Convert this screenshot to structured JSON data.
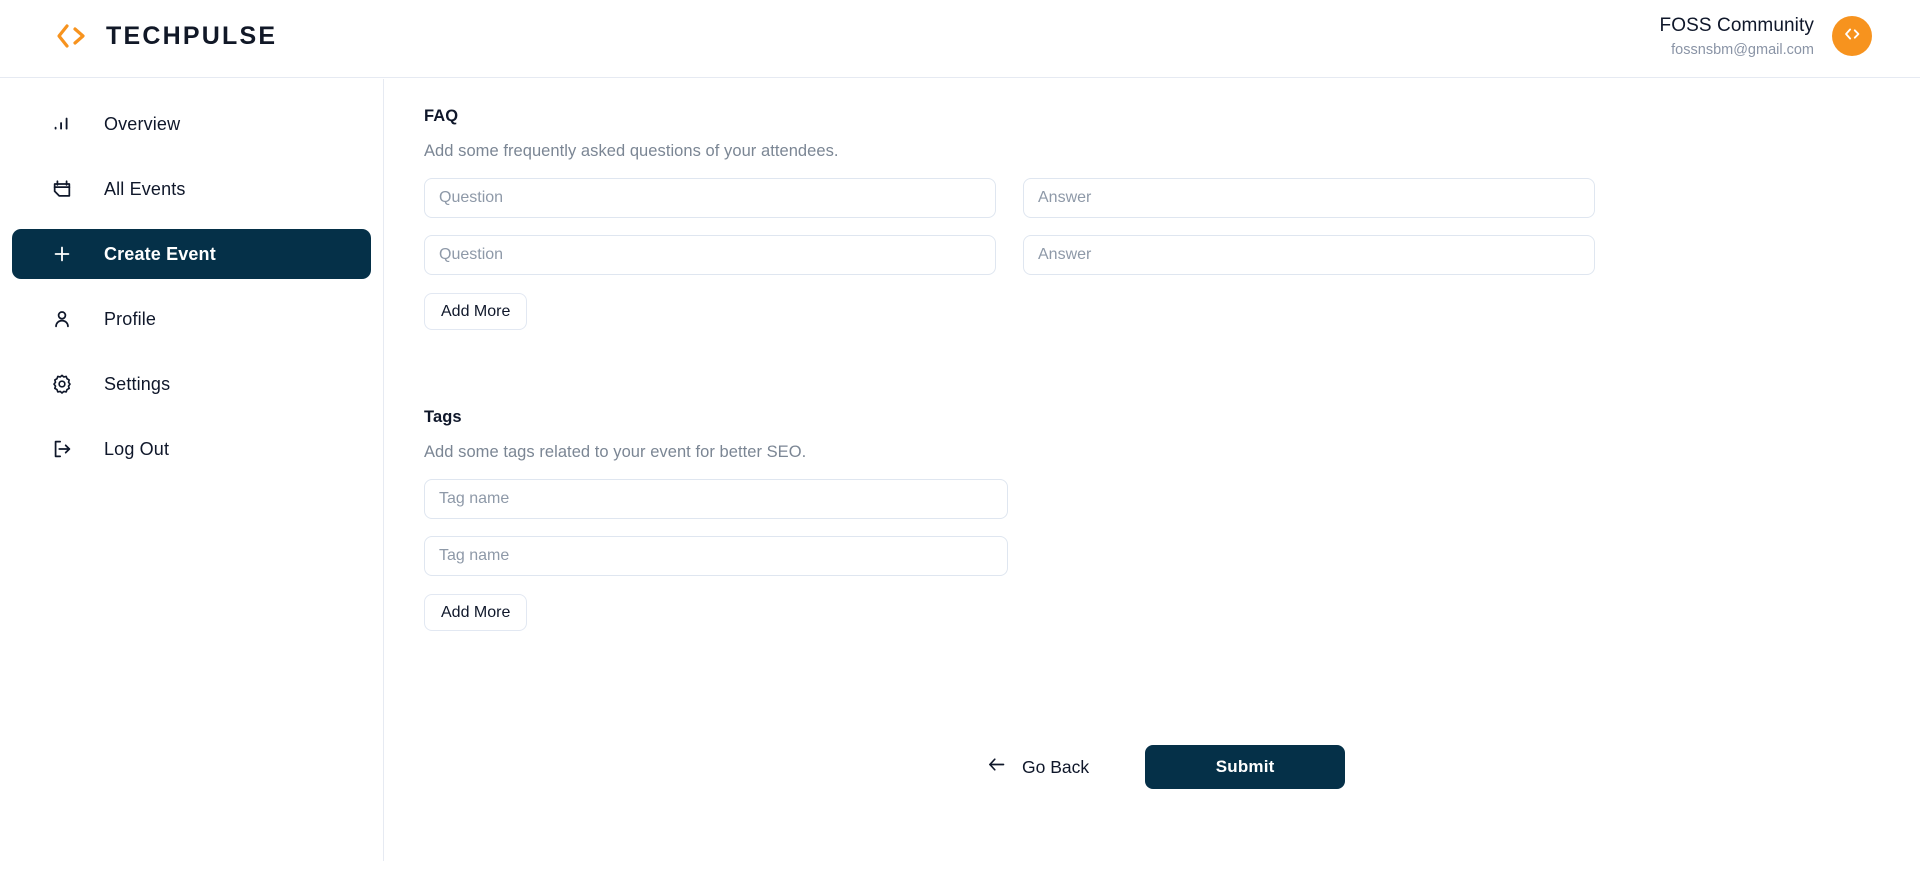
{
  "brand": {
    "name": "TECHPULSE",
    "logo_icon": "code-brackets-icon",
    "accent_color": "#F7931E"
  },
  "header": {
    "user_name": "FOSS Community",
    "user_email": "fossnsbm@gmail.com",
    "avatar_icon": "code-brackets-icon",
    "avatar_color": "#F7931E"
  },
  "sidebar": {
    "items": [
      {
        "label": "Overview",
        "icon": "bar-chart-icon",
        "active": false
      },
      {
        "label": "All Events",
        "icon": "calendar-icon",
        "active": false
      },
      {
        "label": "Create Event",
        "icon": "plus-icon",
        "active": true
      },
      {
        "label": "Profile",
        "icon": "user-icon",
        "active": false
      },
      {
        "label": "Settings",
        "icon": "gear-icon",
        "active": false
      },
      {
        "label": "Log Out",
        "icon": "logout-icon",
        "active": false
      }
    ],
    "active_color": "#053048"
  },
  "main": {
    "faq": {
      "title": "FAQ",
      "subtitle": "Add some frequently asked questions of your attendees.",
      "rows": [
        {
          "question_placeholder": "Question",
          "question_value": "",
          "answer_placeholder": "Answer",
          "answer_value": ""
        },
        {
          "question_placeholder": "Question",
          "question_value": "",
          "answer_placeholder": "Answer",
          "answer_value": ""
        }
      ],
      "add_more_label": "Add More"
    },
    "tags": {
      "title": "Tags",
      "subtitle": "Add some tags related to your event for better SEO.",
      "rows": [
        {
          "placeholder": "Tag name",
          "value": ""
        },
        {
          "placeholder": "Tag name",
          "value": ""
        }
      ],
      "add_more_label": "Add More"
    }
  },
  "actions": {
    "go_back_label": "Go Back",
    "go_back_icon": "arrow-left-icon",
    "submit_label": "Submit",
    "submit_color": "#053048"
  }
}
